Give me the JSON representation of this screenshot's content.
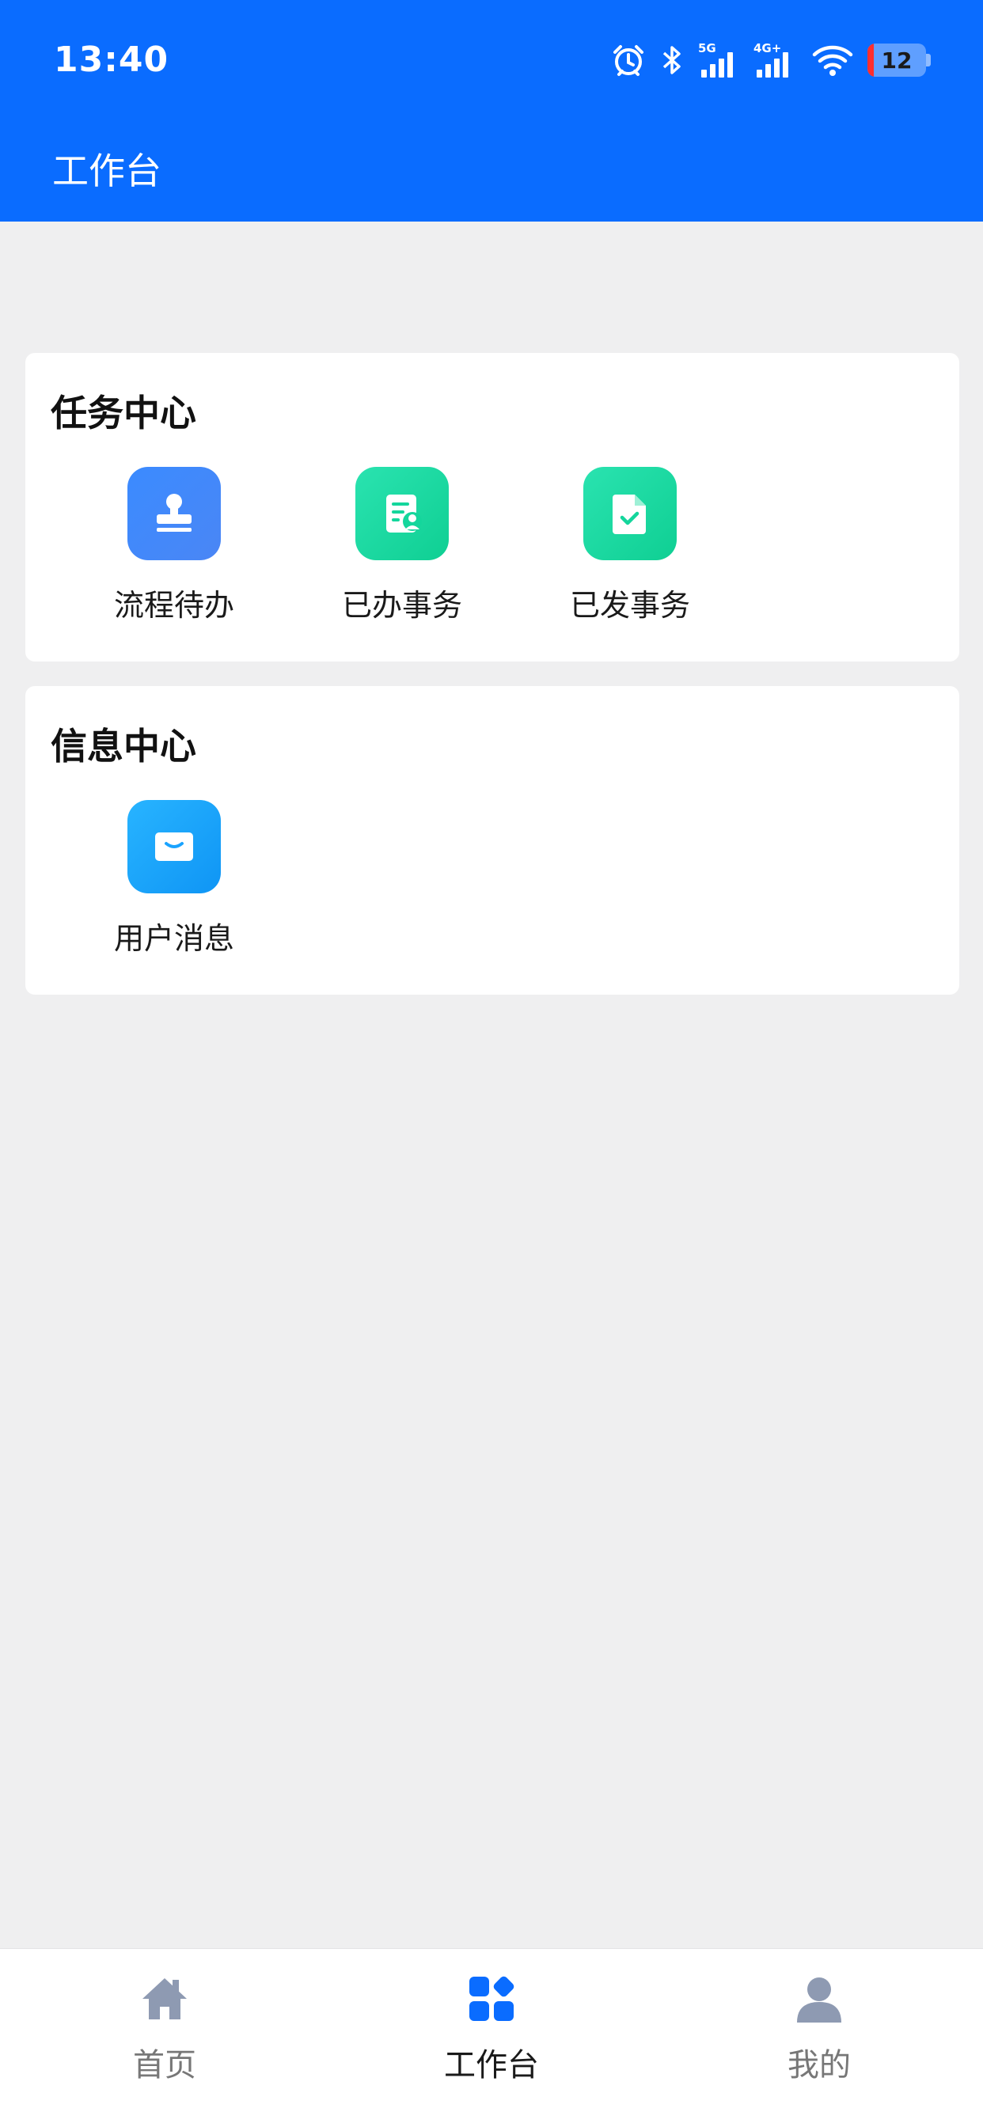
{
  "status_bar": {
    "time": "13:40",
    "network_5g": "5G",
    "network_4g": "4G+",
    "battery": "12",
    "icons": [
      "alarm-icon",
      "bluetooth-icon",
      "signal-5g-icon",
      "signal-4g-icon",
      "wifi-icon",
      "battery-icon"
    ]
  },
  "header": {
    "title": "工作台"
  },
  "colors": {
    "brand": "#0a6cff",
    "background": "#efeff0",
    "battery_low": "#ff2e2e",
    "tab_inactive": "#8e9ab2",
    "tab_active": "#0a6cff"
  },
  "task_center": {
    "title": "任务中心",
    "items": [
      {
        "label": "流程待办",
        "icon": "stamp-icon",
        "color": "#3b8bff"
      },
      {
        "label": "已办事务",
        "icon": "document-user-icon",
        "color": "#14d69c"
      },
      {
        "label": "已发事务",
        "icon": "file-check-icon",
        "color": "#14d69c"
      }
    ]
  },
  "info_center": {
    "title": "信息中心",
    "items": [
      {
        "label": "用户消息",
        "icon": "mail-icon",
        "color": "#1aa3ff"
      }
    ]
  },
  "tabbar": {
    "items": [
      {
        "label": "首页",
        "icon": "home-icon",
        "active": false
      },
      {
        "label": "工作台",
        "icon": "grid-icon",
        "active": true
      },
      {
        "label": "我的",
        "icon": "user-icon",
        "active": false
      }
    ]
  }
}
